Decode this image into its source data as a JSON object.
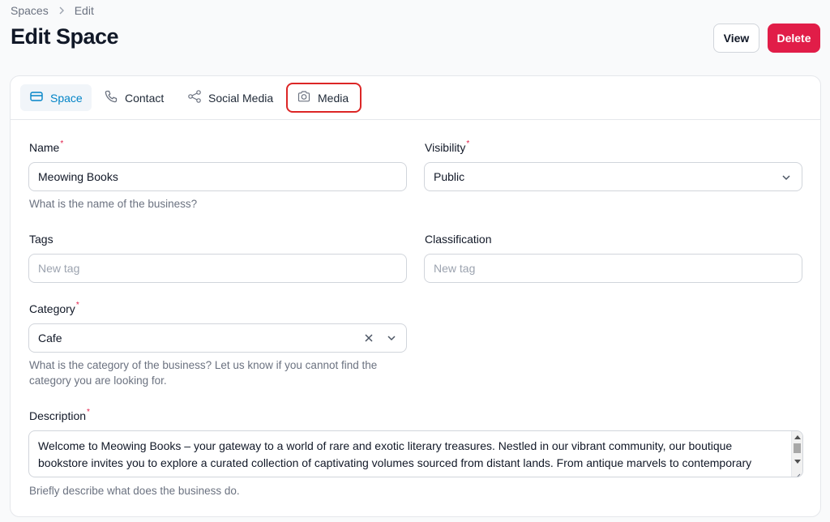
{
  "breadcrumb": {
    "items": [
      "Spaces",
      "Edit"
    ]
  },
  "header": {
    "title": "Edit Space",
    "view_label": "View",
    "delete_label": "Delete"
  },
  "colors": {
    "accent": "#0284c7",
    "danger": "#e11d48",
    "highlight": "#dc2626"
  },
  "tabs": [
    {
      "label": "Space",
      "icon": "card-icon",
      "active": true
    },
    {
      "label": "Contact",
      "icon": "phone-icon",
      "active": false
    },
    {
      "label": "Social Media",
      "icon": "share-icon",
      "active": false
    },
    {
      "label": "Media",
      "icon": "camera-icon",
      "active": false,
      "highlighted": true
    }
  ],
  "form": {
    "name": {
      "label": "Name",
      "required_mark": "*",
      "value": "Meowing Books",
      "helper": "What is the name of the business?"
    },
    "visibility": {
      "label": "Visibility",
      "required_mark": "*",
      "value": "Public"
    },
    "tags": {
      "label": "Tags",
      "placeholder": "New tag"
    },
    "classification": {
      "label": "Classification",
      "placeholder": "New tag"
    },
    "category": {
      "label": "Category",
      "required_mark": "*",
      "value": "Cafe",
      "helper": "What is the category of the business? Let us know if you cannot find the category you are looking for."
    },
    "description": {
      "label": "Description",
      "required_mark": "*",
      "value": "Welcome to Meowing Books – your gateway to a world of rare and exotic literary treasures. Nestled in our vibrant community, our boutique bookstore invites you to explore a curated collection of captivating volumes sourced from distant lands. From antique marvels to contemporary",
      "helper": "Briefly describe what does the business do."
    }
  }
}
